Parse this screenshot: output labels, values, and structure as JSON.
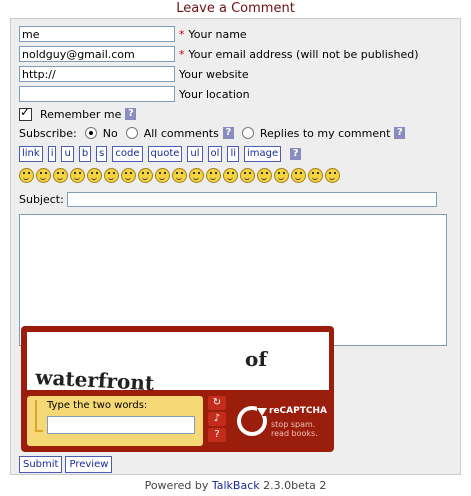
{
  "title": "Leave a Comment",
  "fields": {
    "name": {
      "value": "me",
      "label": "Your name",
      "required": "*"
    },
    "email": {
      "value": "noldguy@gmail.com",
      "label": "Your email address (will not be published)",
      "required": "*"
    },
    "website": {
      "value": "http://",
      "label": "Your website"
    },
    "location": {
      "value": "",
      "label": "Your location"
    }
  },
  "remember": {
    "label": "Remember me",
    "checked": true,
    "help": "?"
  },
  "subscribe": {
    "label": "Subscribe:",
    "options": [
      "No",
      "All comments",
      "Replies to my comment"
    ],
    "selected": "No",
    "help": "?"
  },
  "format_buttons": [
    "link",
    "i",
    "u",
    "b",
    "s",
    "code",
    "quote",
    "ul",
    "ol",
    "li",
    "image"
  ],
  "format_help": "?",
  "smileys": [
    "smile-icon",
    "sad-icon",
    "grin-icon",
    "laugh-icon",
    "teeth-icon",
    "wink-icon",
    "worried-icon",
    "smirk-icon",
    "cool-icon",
    "big-grin-icon",
    "neutral-icon",
    "happy-icon",
    "confused-icon",
    "angry-icon",
    "mad-icon",
    "cry-icon",
    "eek-icon",
    "surprised-icon",
    "shock-icon"
  ],
  "subject": {
    "label": "Subject:",
    "value": ""
  },
  "comment": {
    "value": ""
  },
  "captcha": {
    "word1": "waterfront",
    "word2": "of",
    "prompt": "Type the two words:",
    "brand": "reCAPTCHA",
    "tagline1": "stop spam.",
    "tagline2": "read books.",
    "icons": [
      "refresh-icon",
      "audio-icon",
      "help-icon"
    ]
  },
  "buttons": {
    "submit": "Submit",
    "preview": "Preview"
  },
  "footer": {
    "prefix": "Powered by",
    "link": "TalkBack",
    "version": "2.3.0beta 2"
  }
}
